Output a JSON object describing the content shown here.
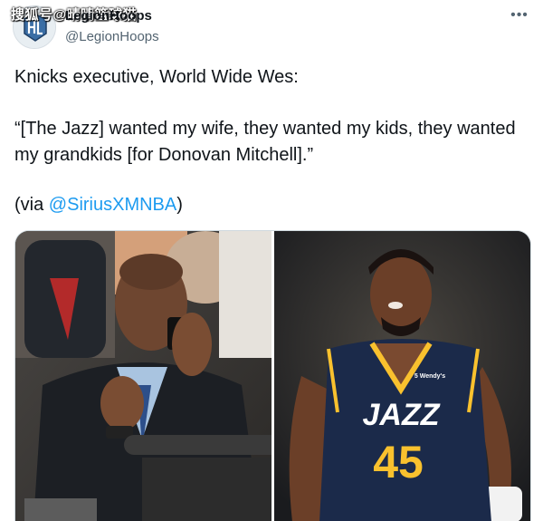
{
  "header": {
    "display_name": "LegionHoops",
    "handle": "@LegionHoops",
    "watermark": "搜狐号@晴晴篮球猫"
  },
  "icons": {
    "avatar": "legion-hoops-logo",
    "more": "more-options-icon"
  },
  "more_label": "•••",
  "tweet": {
    "line1": "Knicks executive, World Wide Wes:",
    "quote": "“[The Jazz] wanted my wife, they wanted my kids, they wanted my grandkids [for Donovan Mitchell].”",
    "via_prefix": "(via ",
    "via_mention": "@SiriusXMNBA",
    "via_suffix": ")"
  },
  "media": {
    "jersey_brand": "JAZZ",
    "jersey_number": "45",
    "jersey_patch": "5 Wendy's"
  },
  "colors": {
    "text": "#0f1419",
    "secondary": "#536471",
    "link": "#1d9bf0",
    "jazz_navy": "#1b2a4a",
    "jazz_yellow": "#f9c12e"
  }
}
